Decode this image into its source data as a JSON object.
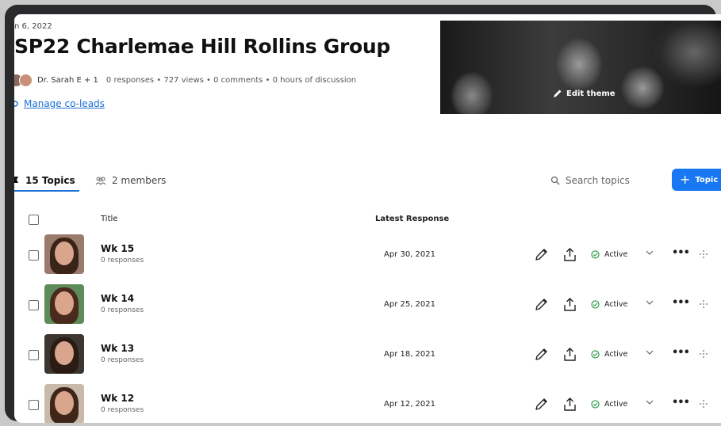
{
  "group": {
    "date": "n 6, 2022",
    "title": "SP22 Charlemae Hill Rollins Group",
    "lead": "Dr. Sarah E + 1",
    "stats": "0 responses • 727 views • 0 comments • 0 hours of discussion",
    "manage_coleads": "Manage co-leads",
    "edit_theme": "Edit theme"
  },
  "tabs": {
    "topics": "15 Topics",
    "members": "2 members"
  },
  "search": {
    "placeholder": "Search topics"
  },
  "add_topic": {
    "label": "Topic"
  },
  "table": {
    "col_title": "Title",
    "col_latest": "Latest Response",
    "rows": [
      {
        "name": "Wk 15",
        "responses": "0 responses",
        "latest": "Apr 30, 2021",
        "status": "Active",
        "bg": "#9a7a6a",
        "hair": "#3a2418"
      },
      {
        "name": "Wk 14",
        "responses": "0 responses",
        "latest": "Apr 25, 2021",
        "status": "Active",
        "bg": "#5e8b5a",
        "hair": "#4a2a1c"
      },
      {
        "name": "Wk 13",
        "responses": "0 responses",
        "latest": "Apr 18, 2021",
        "status": "Active",
        "bg": "#3b3630",
        "hair": "#2a1c14"
      },
      {
        "name": "Wk 12",
        "responses": "0 responses",
        "latest": "Apr 12, 2021",
        "status": "Active",
        "bg": "#c9b9a8",
        "hair": "#3e2618"
      }
    ]
  },
  "colors": {
    "accent": "#1877f2",
    "link": "#1a6fd6",
    "active": "#2e9d4a"
  },
  "icons": [
    "flag-icon",
    "members-icon",
    "search-icon",
    "plus-icon",
    "pencil-icon",
    "edit-icon",
    "share-icon",
    "check-circle-icon",
    "chevron-down-icon",
    "more-icon",
    "drag-handle-icon",
    "link-icon"
  ]
}
